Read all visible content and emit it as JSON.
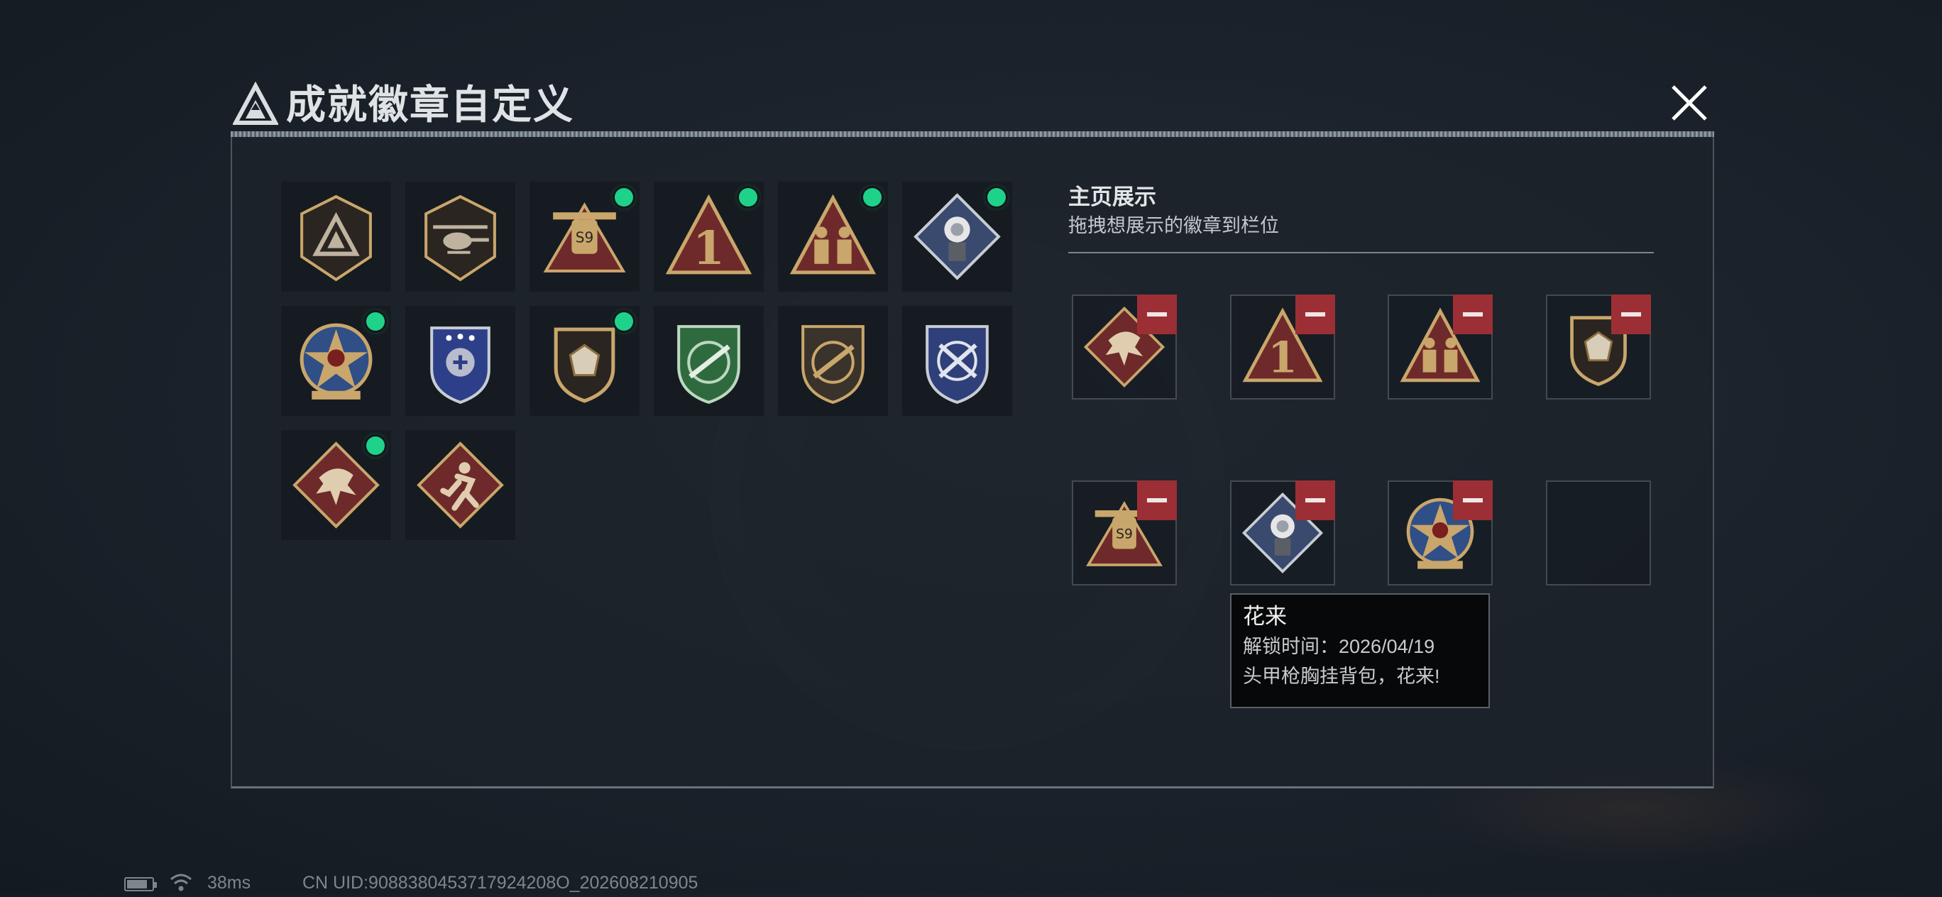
{
  "window": {
    "title": "成就徽章自定义",
    "close_icon": "close-icon",
    "logo_icon": "triangle-logo-icon"
  },
  "badge_collection": [
    {
      "icon": "triangle-logo-badge-icon",
      "new": false
    },
    {
      "icon": "helicopter-badge-icon",
      "new": false
    },
    {
      "icon": "vehicle-wings-badge-icon",
      "new": true
    },
    {
      "icon": "number-one-badge-icon",
      "new": true
    },
    {
      "icon": "soldiers-triangle-badge-icon",
      "new": true
    },
    {
      "icon": "rose-diamond-badge-icon",
      "new": true
    },
    {
      "icon": "star-skull-medal-icon",
      "new": true
    },
    {
      "icon": "blue-police-shield-icon",
      "new": false
    },
    {
      "icon": "gem-shield-badge-icon",
      "new": true
    },
    {
      "icon": "green-rifle-shield-icon",
      "new": false
    },
    {
      "icon": "gold-rifle-shield-icon",
      "new": false
    },
    {
      "icon": "blue-crossed-rifles-shield-icon",
      "new": false
    },
    {
      "icon": "dragon-diamond-badge-icon",
      "new": true
    },
    {
      "icon": "runner-diamond-badge-icon",
      "new": false
    }
  ],
  "showcase": {
    "title": "主页展示",
    "subtitle": "拖拽想展示的徽章到栏位",
    "slots": [
      {
        "icon": "dragon-diamond-badge-icon",
        "filled": true
      },
      {
        "icon": "number-one-badge-icon",
        "filled": true
      },
      {
        "icon": "soldiers-triangle-badge-icon",
        "filled": true
      },
      {
        "icon": "gem-shield-badge-icon",
        "filled": true
      },
      {
        "icon": "vehicle-wings-badge-icon",
        "filled": true
      },
      {
        "icon": "rose-diamond-badge-icon",
        "filled": true
      },
      {
        "icon": "star-skull-medal-icon",
        "filled": true
      },
      {
        "icon": "",
        "filled": false
      }
    ]
  },
  "tooltip": {
    "name": "花来",
    "unlock": "解锁时间：2026/04/19",
    "description": "头甲枪胸挂背包，花来!"
  },
  "status_bar": {
    "ping": "38ms",
    "uid": "CN UID:9088380453717924208O_202608210905"
  },
  "colors": {
    "gold": "#c9a66b",
    "crimson": "#7a2a2a",
    "new_dot": "#1fd28a",
    "remove": "#9c2f35"
  }
}
